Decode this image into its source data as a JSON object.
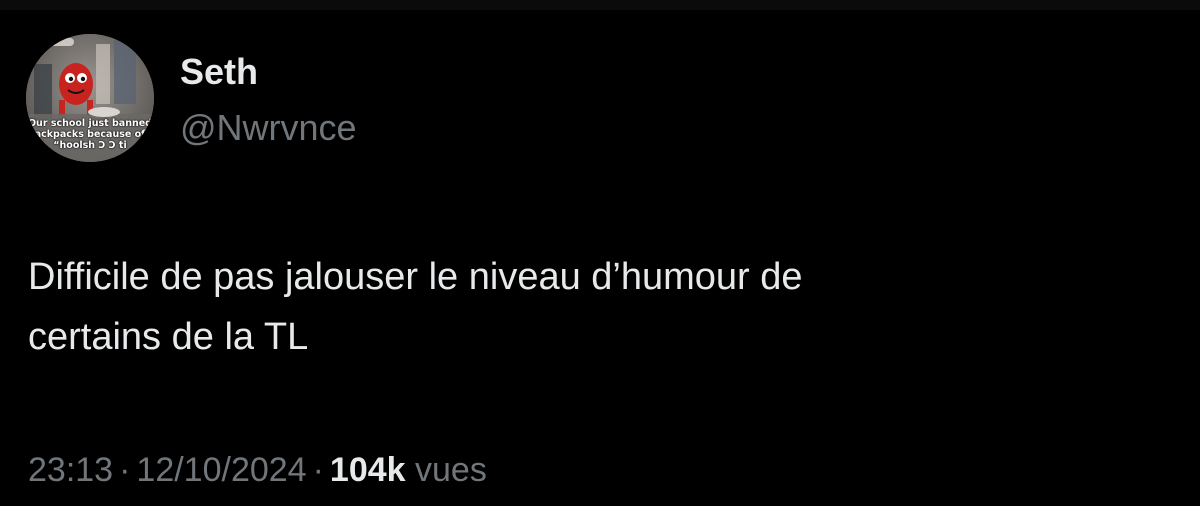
{
  "tweet": {
    "author": {
      "display_name": "Seth",
      "handle": "@Nwrvnce",
      "avatar_caption": [
        "Our school just banned",
        "ackpacks because of",
        "“hoolsh Ɔ Ɔ ti"
      ]
    },
    "text_lines": [
      "Difficile de pas jalouser le niveau d’humour de",
      "certains de la TL"
    ],
    "meta": {
      "time": "23:13",
      "separator": "·",
      "date": "12/10/2024",
      "views_count": "104k",
      "views_label": "vues"
    }
  },
  "colors": {
    "background": "#000000",
    "primary_text": "#e7e9ea",
    "secondary_text": "#71767b"
  }
}
